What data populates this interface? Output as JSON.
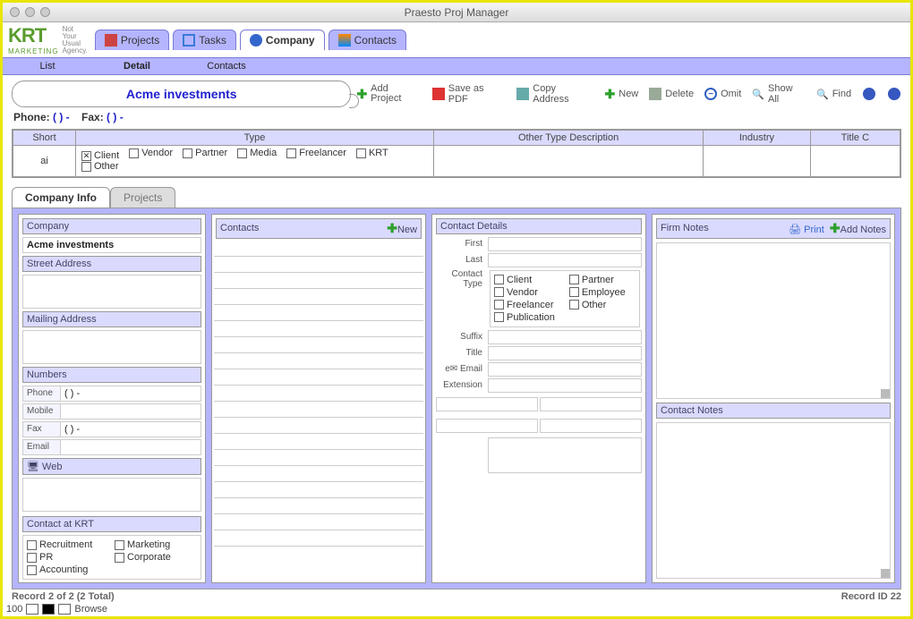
{
  "window": {
    "title": "Praesto Proj Manager"
  },
  "logo": {
    "brand": "KRT",
    "sub": "MARKETING",
    "tag1": "Not",
    "tag2": "Your",
    "tag3": "Usual",
    "tag4": "Agency."
  },
  "tabs": {
    "projects": "Projects",
    "tasks": "Tasks",
    "company": "Company",
    "contacts": "Contacts"
  },
  "subnav": {
    "list": "List",
    "detail": "Detail",
    "contacts": "Contacts"
  },
  "company_name": "Acme investments",
  "toolbar": {
    "add_project": "Add Project",
    "save_pdf": "Save as PDF",
    "copy_address": "Copy Address",
    "new": "New",
    "delete": "Delete",
    "omit": "Omit",
    "show_all": "Show All",
    "find": "Find"
  },
  "phone_fax": {
    "phone_label": "Phone:",
    "phone_val": "( ) -",
    "fax_label": "Fax:",
    "fax_val": "( ) -"
  },
  "grid": {
    "headers": {
      "short": "Short",
      "type": "Type",
      "other": "Other Type Description",
      "industry": "Industry",
      "titlec": "Title C"
    },
    "short_val": "ai",
    "types": {
      "client": "Client",
      "vendor": "Vendor",
      "partner": "Partner",
      "media": "Media",
      "freelancer": "Freelancer",
      "krt": "KRT",
      "other": "Other"
    }
  },
  "sub_tabs": {
    "info": "Company Info",
    "projects": "Projects"
  },
  "panels": {
    "company": "Company",
    "company_val": "Acme investments",
    "street": "Street Address",
    "mailing": "Mailing Address",
    "numbers": "Numbers",
    "phone": "Phone",
    "phone_v": "( ) -",
    "mobile": "Mobile",
    "fax": "Fax",
    "fax_v": "( ) -",
    "email": "Email",
    "web": "Web",
    "krt_contact": "Contact at KRT",
    "krt": {
      "recruitment": "Recruitment",
      "marketing": "Marketing",
      "pr": "PR",
      "corporate": "Corporate",
      "accounting": "Accounting"
    },
    "contacts": "Contacts",
    "new": "New",
    "contact_details": "Contact Details",
    "cd": {
      "first": "First",
      "last": "Last",
      "ctype": "Contact Type",
      "suffix": "Suffix",
      "title": "Title",
      "email": "Email",
      "ext": "Extension"
    },
    "ctype": {
      "client": "Client",
      "vendor": "Vendor",
      "freelancer": "Freelancer",
      "publication": "Publication",
      "partner": "Partner",
      "employee": "Employee",
      "other": "Other"
    },
    "firm_notes": "Firm Notes",
    "print": "Print",
    "add_notes": "Add Notes",
    "contact_notes": "Contact Notes"
  },
  "status": {
    "left": "Record 2 of 2 (2 Total)",
    "right": "Record ID 22",
    "zoom": "100",
    "mode": "Browse"
  }
}
